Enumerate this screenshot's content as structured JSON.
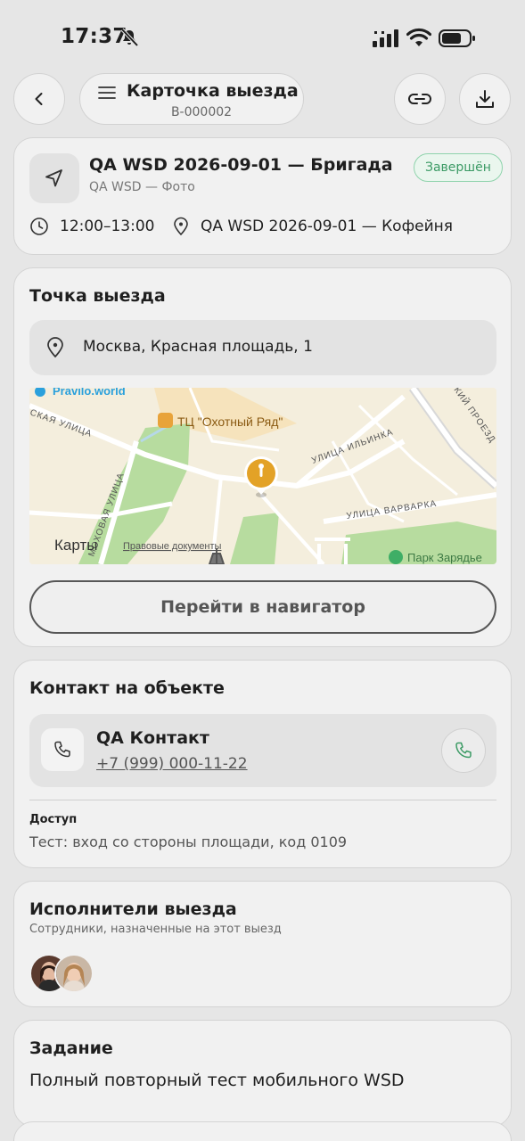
{
  "status_bar": {
    "time": "17:37",
    "icons": [
      "bell-muted-icon",
      "signal-icon",
      "wifi-icon",
      "battery-icon"
    ]
  },
  "header": {
    "title": "Карточка выезда",
    "subtitle": "В-000002",
    "icons": [
      "back-arrow-icon",
      "menu-icon",
      "link-icon",
      "download-icon"
    ]
  },
  "order": {
    "title": "QA WSD 2026-09-01 — Бригада",
    "subtitle": "QA WSD — Фото",
    "status": "Завершён",
    "time_range": "12:00–13:00",
    "place": "QA WSD 2026-09-01 — Кофейня",
    "status_color": "#3b9a64"
  },
  "location": {
    "section_title": "Точка выезда",
    "address": "Москва, Красная площадь, 1",
    "map_labels": {
      "top_left": "Pravilo.world",
      "street_left": "СКАЯ УЛИЦА",
      "mall": "ТЦ \"Охотный Ряд\"",
      "mokhovaya": "МОХОВАЯ УЛИЦА",
      "ilyinka": "УЛИЦА ИЛЬИНКА",
      "varvarka": "УЛИЦА ВАРВАРКА",
      "proezd": "КИЙ ПРОЕЗД",
      "brand": "Карты",
      "legal": "Правовые документы",
      "park": "Парк Зарядье"
    },
    "navigator_button": "Перейти в навигатор"
  },
  "contact": {
    "section_title": "Контакт на объекте",
    "name": "QA Контакт",
    "phone": "+7 (999) 000-11-22",
    "access_label": "Доступ",
    "access_text": "Тест: вход со стороны площади, код 0109",
    "call_color": "#3b9a64"
  },
  "executors": {
    "section_title": "Исполнители выезда",
    "subtitle": "Сотрудники, назначенные на этот выезд"
  },
  "task": {
    "section_title": "Задание",
    "text": "Полный повторный тест мобильного WSD"
  }
}
